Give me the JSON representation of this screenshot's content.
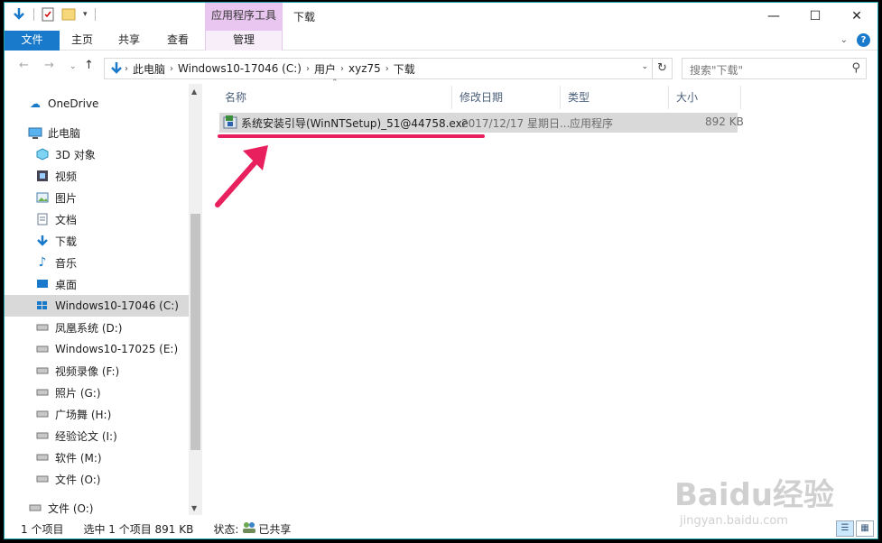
{
  "titlebar": {
    "context_tab": "应用程序工具",
    "title": "下载",
    "minimize": "—",
    "maximize": "☐",
    "close": "✕"
  },
  "ribbon": {
    "tabs": [
      "文件",
      "主页",
      "共享",
      "查看",
      "管理"
    ]
  },
  "address": {
    "segments": [
      "此电脑",
      "Windows10-17046 (C:)",
      "用户",
      "xyz75",
      "下载"
    ],
    "search_placeholder": "搜索\"下载\""
  },
  "nav": {
    "items": [
      {
        "label": "OneDrive",
        "icon": "cloud-icon"
      },
      {
        "label": "此电脑",
        "icon": "computer-icon"
      },
      {
        "label": "3D 对象",
        "icon": "cube-icon"
      },
      {
        "label": "视频",
        "icon": "video-icon"
      },
      {
        "label": "图片",
        "icon": "picture-icon"
      },
      {
        "label": "文档",
        "icon": "document-icon"
      },
      {
        "label": "下载",
        "icon": "download-icon"
      },
      {
        "label": "音乐",
        "icon": "music-icon"
      },
      {
        "label": "桌面",
        "icon": "desktop-icon"
      },
      {
        "label": "Windows10-17046 (C:)",
        "icon": "system-drive-icon"
      },
      {
        "label": "凤凰系统 (D:)",
        "icon": "drive-icon"
      },
      {
        "label": "Windows10-17025 (E:)",
        "icon": "drive-icon"
      },
      {
        "label": "视频录像 (F:)",
        "icon": "drive-icon"
      },
      {
        "label": "照片 (G:)",
        "icon": "drive-icon"
      },
      {
        "label": "广场舞 (H:)",
        "icon": "drive-icon"
      },
      {
        "label": "经验论文 (I:)",
        "icon": "drive-icon"
      },
      {
        "label": "软件 (M:)",
        "icon": "drive-icon"
      },
      {
        "label": "文件 (O:)",
        "icon": "drive-icon"
      },
      {
        "label": "文件 (O:)",
        "icon": "drive-icon"
      }
    ]
  },
  "columns": [
    "名称",
    "修改日期",
    "类型",
    "大小"
  ],
  "files": [
    {
      "name": "系统安装引导(WinNTSetup)_51@44758.exe",
      "date": "2017/12/17 星期日...",
      "type": "应用程序",
      "size": "892 KB"
    }
  ],
  "status": {
    "count": "1 个项目",
    "selected": "选中 1 个项目  891 KB",
    "state": "状态:",
    "shared": "已共享"
  },
  "watermark": {
    "brand": "Baidu经验",
    "url": "jingyan.baidu.com"
  },
  "colors": {
    "accent": "#1979ca",
    "selection": "#cce8ff",
    "context_tab": "#e9c6ef",
    "annotation": "#e8205e"
  }
}
